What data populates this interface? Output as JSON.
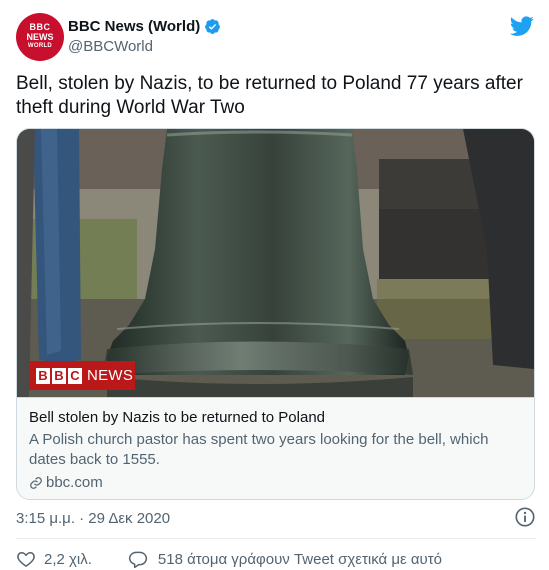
{
  "account": {
    "avatar_lines": [
      "BBC",
      "NEWS",
      "WORLD"
    ],
    "display_name": "BBC News (World)",
    "handle": "@BBCWorld",
    "verified": true,
    "platform_icon": "twitter-bird-icon"
  },
  "tweet": {
    "text": "Bell, stolen by Nazis, to be returned to Poland 77 years after theft during World War Two",
    "timestamp": "3:15 μ.μ. · 29 Δεκ 2020"
  },
  "card": {
    "badge_letters": [
      "B",
      "B",
      "C"
    ],
    "badge_label": "NEWS",
    "title": "Bell stolen by Nazis to be returned to Poland",
    "description": "A Polish church pastor has spent two years looking for the bell, which dates back to 1555.",
    "domain": "bbc.com"
  },
  "actions": {
    "likes": "2,2 χιλ.",
    "replies": "518 άτομα γράφουν Tweet σχετικά με αυτό"
  },
  "colors": {
    "brand_red": "#bb1919",
    "twitter_blue": "#1da1f2",
    "secondary_text": "#536471"
  }
}
